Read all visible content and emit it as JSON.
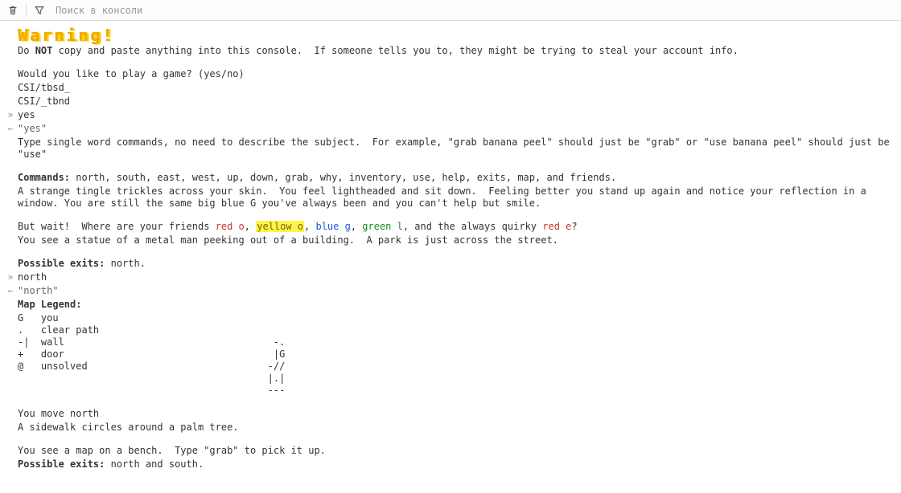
{
  "toolbar": {
    "clear_tooltip": "Clear",
    "filter_tooltip": "Filter",
    "search_placeholder": "Поиск в консоли"
  },
  "warning_title": "Warning!",
  "do_not_line": {
    "prefix": "Do ",
    "not": "NOT",
    "suffix": " copy and paste anything into this console.  If someone tells you to, they might be trying to steal your account info."
  },
  "prompt_play": "Would you like to play a game? (yes/no)",
  "csi1": "CSI/tbsd_",
  "csi2": "CSI/_tbnd",
  "input_yes": "yes",
  "echo_yes": "\"yes\"",
  "help_line": "Type single word commands, no need to describe the subject.  For example, \"grab banana peel\" should just be \"grab\" or \"use banana peel\" should just be \"use\"",
  "commands_label": "Commands:",
  "commands_list": " north, south, east, west, up, down, grab, why, inventory, use, help, exits, map, and friends.",
  "tingle_line": "A strange tingle trickles across your skin.  You feel lightheaded and sit down.  Feeling better you stand up again and notice your reflection in a window. You are still the same big blue G you've always been and you can't help but smile.",
  "friends": {
    "prefix": "But wait!  Where are your friends ",
    "red_o": "red o",
    "c1": ", ",
    "yellow_o": "yellow o",
    "c2": ", ",
    "blue_g": "blue g",
    "c3": ", ",
    "green_l": "green l",
    "c4": ", and the always quirky ",
    "red_e": "red e",
    "suffix": "?"
  },
  "statue_line": "You see a statue of a metal man peeking out of a building.  A park is just across the street.",
  "exits1_label": "Possible exits:",
  "exits1_value": " north.",
  "input_north": "north",
  "echo_north": "\"north\"",
  "legend_title": "Map Legend:",
  "legend_block": "G   you\n.   clear path\n-|  wall                                    -.\n+   door                                    |G\n@   unsolved                               -//\n                                           |.|\n                                           ---",
  "move_north": "You move north",
  "sidewalk": "A sidewalk circles around a palm tree.",
  "map_bench": "You see a map on a bench.  Type \"grab\" to pick it up.",
  "exits2_label": "Possible exits:",
  "exits2_value": " north and south."
}
